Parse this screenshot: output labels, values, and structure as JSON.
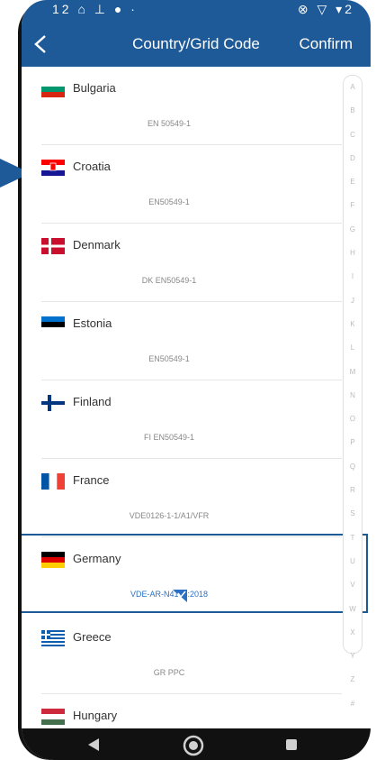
{
  "statusbar": {
    "left": "12 ⌂ ⊥ ● ·",
    "right": "⊗ ▽ ▾2"
  },
  "header": {
    "title": "Country/Grid Code",
    "confirm": "Confirm"
  },
  "countries": [
    {
      "name": "Bulgaria",
      "code": "EN 50549-1"
    },
    {
      "name": "Croatia",
      "code": "EN50549-1"
    },
    {
      "name": "Denmark",
      "code": "DK EN50549-1"
    },
    {
      "name": "Estonia",
      "code": "EN50549-1"
    },
    {
      "name": "Finland",
      "code": "FI EN50549-1"
    },
    {
      "name": "France",
      "code": "VDE0126-1-1/A1/VFR"
    },
    {
      "name": "Germany",
      "code": "VDE-AR-N4105:2018"
    },
    {
      "name": "Greece",
      "code": "GR PPC"
    },
    {
      "name": "Hungary",
      "code": ""
    }
  ],
  "index": [
    "A",
    "B",
    "C",
    "D",
    "E",
    "F",
    "G",
    "H",
    "I",
    "J",
    "K",
    "L",
    "M",
    "N",
    "O",
    "P",
    "Q",
    "R",
    "S",
    "T",
    "U",
    "V",
    "W",
    "X",
    "Y",
    "Z",
    "#"
  ],
  "colors": {
    "header": "#1e5a97",
    "selected_code": "#2a6fc4"
  }
}
